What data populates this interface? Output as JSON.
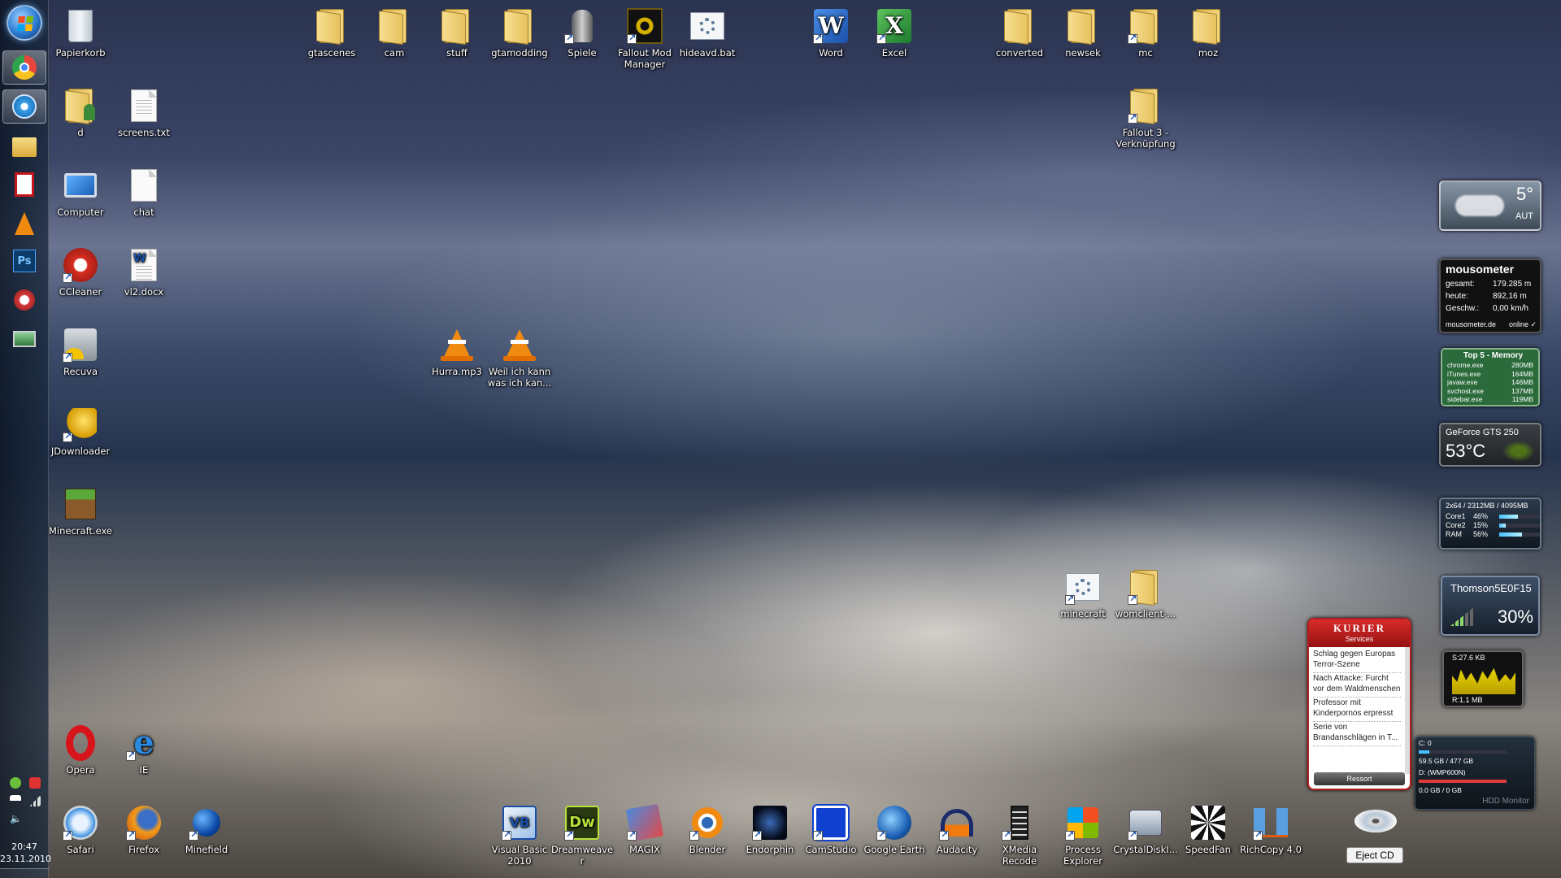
{
  "taskbar": {
    "pinned": [
      {
        "name": "chrome",
        "color": "#e8453c"
      },
      {
        "name": "itunes",
        "color": "#3aa0e8"
      },
      {
        "name": "explorer",
        "color": "#f2c84b"
      },
      {
        "name": "acrobat",
        "color": "#c4161c"
      },
      {
        "name": "vlc",
        "color": "#f08a10"
      },
      {
        "name": "photoshop",
        "color": "#1b6fb3"
      },
      {
        "name": "snipping-tool",
        "color": "#d53a3a"
      },
      {
        "name": "monitor",
        "color": "#5aa86a"
      }
    ],
    "clock": {
      "time": "20:47",
      "date": "23.11.2010"
    }
  },
  "desktop": {
    "left_column": [
      {
        "label": "Papierkorb",
        "kind": "recycle-bin"
      },
      {
        "label": "d",
        "kind": "user-folder"
      },
      {
        "label": "screens.txt",
        "kind": "text-file"
      },
      {
        "label": "Computer",
        "kind": "computer"
      },
      {
        "label": "chat",
        "kind": "file"
      },
      {
        "label": "CCleaner",
        "kind": "ccleaner"
      },
      {
        "label": "vl2.docx",
        "kind": "word-doc"
      },
      {
        "label": "Recuva",
        "kind": "recuva"
      },
      {
        "label": "JDownloader",
        "kind": "jdownloader"
      },
      {
        "label": "Minecraft.exe",
        "kind": "minecraft"
      },
      {
        "label": "Opera",
        "kind": "opera"
      },
      {
        "label": "IE",
        "kind": "ie"
      }
    ],
    "top_row": [
      {
        "label": "gtascenes",
        "kind": "folder"
      },
      {
        "label": "cam",
        "kind": "folder"
      },
      {
        "label": "stuff",
        "kind": "folder"
      },
      {
        "label": "gtamodding",
        "kind": "folder"
      },
      {
        "label": "Spiele",
        "kind": "games"
      },
      {
        "label": "Fallout Mod Manager",
        "kind": "fomm"
      },
      {
        "label": "hideavd.bat",
        "kind": "bat"
      },
      {
        "label": "Word",
        "kind": "word"
      },
      {
        "label": "Excel",
        "kind": "excel"
      },
      {
        "label": "converted",
        "kind": "folder"
      },
      {
        "label": "newsek",
        "kind": "folder"
      },
      {
        "label": "mc",
        "kind": "folder"
      },
      {
        "label": "moz",
        "kind": "folder"
      },
      {
        "label": "Fallout 3 - Verknüpfung",
        "kind": "folder"
      }
    ],
    "mid": [
      {
        "label": "Hurra.mp3",
        "kind": "vlc"
      },
      {
        "label": "Weil ich kann was ich kan...",
        "kind": "vlc"
      },
      {
        "label": "minecraft",
        "kind": "bat"
      },
      {
        "label": "womclient-...",
        "kind": "folder"
      }
    ],
    "bottom_row": [
      {
        "label": "Safari",
        "kind": "safari"
      },
      {
        "label": "Firefox",
        "kind": "firefox"
      },
      {
        "label": "Minefield",
        "kind": "minefield"
      },
      {
        "label": "Visual Basic 2010",
        "kind": "vb"
      },
      {
        "label": "Dreamweaver",
        "kind": "dw"
      },
      {
        "label": "MAGIX",
        "kind": "magix"
      },
      {
        "label": "Blender",
        "kind": "blender"
      },
      {
        "label": "Endorphin",
        "kind": "endorphin"
      },
      {
        "label": "CamStudio",
        "kind": "camstudio"
      },
      {
        "label": "Google Earth",
        "kind": "gearth"
      },
      {
        "label": "Audacity",
        "kind": "audacity"
      },
      {
        "label": "XMedia Recode",
        "kind": "xmedia"
      },
      {
        "label": "Process Explorer",
        "kind": "procexp"
      },
      {
        "label": "CrystalDiskI...",
        "kind": "crystal"
      },
      {
        "label": "SpeedFan",
        "kind": "speedfan"
      },
      {
        "label": "RichCopy 4.0",
        "kind": "richcopy"
      }
    ]
  },
  "gadgets": {
    "weather": {
      "temp": "5°",
      "location": "AUT"
    },
    "mousometer": {
      "title": "mousometer",
      "rows": [
        {
          "label": "gesamt:",
          "value": "179.285 m"
        },
        {
          "label": "heute:",
          "value": "892,16 m"
        },
        {
          "label": "Geschw.:",
          "value": "0,00 km/h"
        }
      ],
      "site": "mousometer.de",
      "status": "online ✓"
    },
    "top5": {
      "title": "Top 5 - Memory",
      "rows": [
        {
          "proc": "chrome.exe",
          "mem": "280MB"
        },
        {
          "proc": "iTunes.exe",
          "mem": "164MB"
        },
        {
          "proc": "javaw.exe",
          "mem": "146MB"
        },
        {
          "proc": "svchost.exe",
          "mem": "137MB"
        },
        {
          "proc": "sidebar.exe",
          "mem": "119MB"
        }
      ]
    },
    "gpu": {
      "title": "GeForce GTS 250",
      "temp": "53°C"
    },
    "cpu": {
      "header": "2x64 / 2312MB / 4095MB",
      "rows": [
        {
          "name": "Core1",
          "pct": "46%",
          "value": 0.46
        },
        {
          "name": "Core2",
          "pct": "15%",
          "value": 0.15
        },
        {
          "name": "RAM",
          "pct": "56%",
          "value": 0.56
        }
      ]
    },
    "wifi": {
      "network": "Thomson5E0F15",
      "strength": "30%"
    },
    "network": {
      "sent": "S:27.6 KB",
      "received": "R:1.1 MB"
    },
    "kurier": {
      "brand": "KURIER",
      "section": "Services",
      "items": [
        "Schlag gegen Europas Terror-Szene",
        "Nach Attacke: Furcht vor dem Waldmenschen",
        "Professor mit Kinderpornos erpresst",
        "Serie von Brandanschlägen in T..."
      ],
      "footer": "Ressort"
    },
    "hdd": {
      "c_label": "C: 0",
      "c_info": "59.5 GB / 477 GB",
      "c_fill": 0.12,
      "d_label": "D: (WMP600N)",
      "d_info": "0.0 GB / 0 GB",
      "d_fill": 1.0,
      "title": "HDD Monitor"
    },
    "eject": {
      "label": "Eject CD"
    }
  }
}
